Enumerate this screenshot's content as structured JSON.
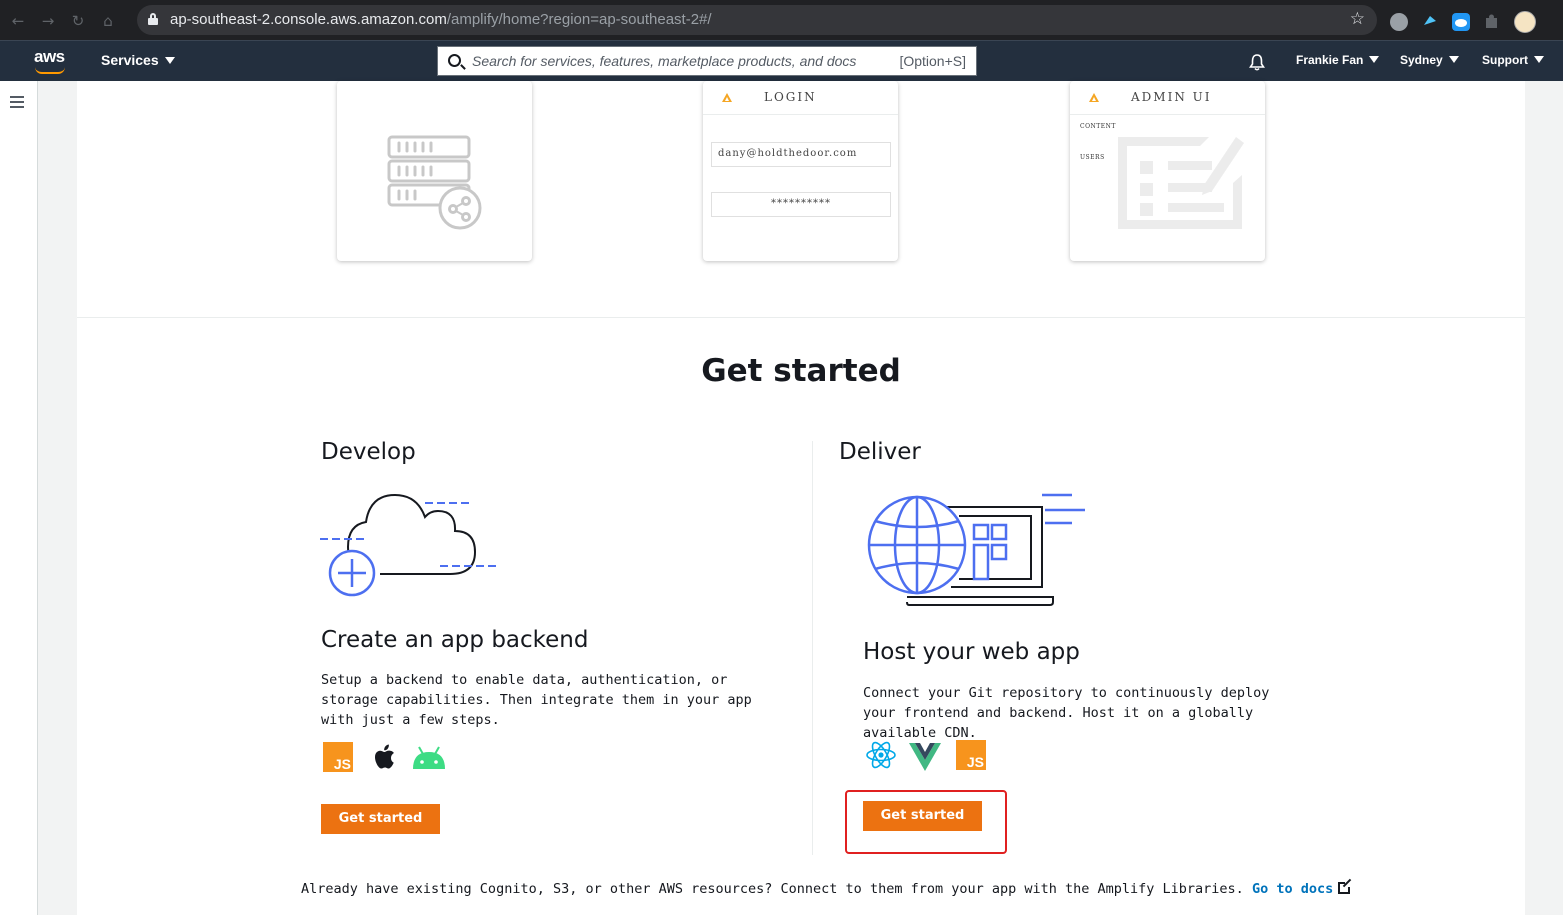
{
  "browser": {
    "url_host": "ap-southeast-2.console.aws.amazon.com",
    "url_path": "/amplify/home?region=ap-southeast-2#/",
    "nav_back": "←",
    "nav_forward": "→",
    "nav_reload": "↻",
    "nav_home": "⌂",
    "bookmark_star": "☆"
  },
  "awsnav": {
    "logo": "aws",
    "services_label": "Services",
    "search_placeholder": "Search for services, features, marketplace products, and docs",
    "search_shortcut": "[Option+S]",
    "user_label": "Frankie Fan",
    "region_label": "Sydney",
    "support_label": "Support"
  },
  "hero_cards": {
    "login_title": "LOGIN",
    "login_email": "dany@holdthedoor.com",
    "login_password": "**********",
    "admin_title": "ADMIN UI",
    "admin_content_label": "CONTENT",
    "admin_users_label": "USERS"
  },
  "get_started": {
    "title": "Get started",
    "develop": {
      "heading": "Develop",
      "subheading": "Create an app backend",
      "description": "Setup a backend to enable data, authentication, or storage capabilities. Then integrate them in your app with just a few steps.",
      "icons": [
        "javascript-icon",
        "apple-icon",
        "android-icon"
      ],
      "js_label": "JS",
      "button_label": "Get started"
    },
    "deliver": {
      "heading": "Deliver",
      "subheading": "Host your web app",
      "description": "Connect your Git repository to continuously deploy your frontend and backend. Host it on a globally available CDN.",
      "icons": [
        "react-icon",
        "vue-icon",
        "javascript-icon"
      ],
      "js_label": "JS",
      "button_label": "Get started"
    },
    "footer_text": "Already have existing Cognito, S3, or other AWS resources? Connect to them from your app with the Amplify Libraries.",
    "footer_link": "Go to docs"
  },
  "colors": {
    "aws_nav_bg": "#232f3e",
    "primary_button": "#ec7211",
    "link": "#0073bb",
    "illustration_blue": "#4d6ff0",
    "highlight_red": "#e02020"
  }
}
